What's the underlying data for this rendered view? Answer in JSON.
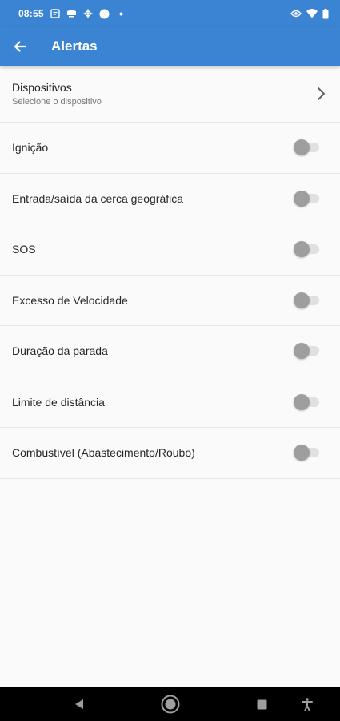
{
  "status_bar": {
    "time": "08:55",
    "icons_left": [
      "notes-icon",
      "message-icon",
      "settings-icon",
      "circle-icon",
      "dot-icon"
    ],
    "icons_right": [
      "eye-icon",
      "wifi-icon",
      "battery-icon"
    ]
  },
  "app_bar": {
    "title": "Alertas",
    "back_icon": "arrow-left-icon",
    "color": "#3a84d3"
  },
  "device_selector": {
    "title": "Dispositivos",
    "subtitle": "Selecione o dispositivo",
    "icon": "chevron-right-icon"
  },
  "alerts": [
    {
      "label": "Ignição",
      "enabled": false
    },
    {
      "label": "Entrada/saída da cerca geográfica",
      "enabled": false
    },
    {
      "label": "SOS",
      "enabled": false
    },
    {
      "label": "Excesso de Velocidade",
      "enabled": false
    },
    {
      "label": "Duração da parada",
      "enabled": false
    },
    {
      "label": "Limite de distância",
      "enabled": false
    },
    {
      "label": "Combustível (Abastecimento/Roubo)",
      "enabled": false
    }
  ],
  "nav_bar": {
    "icons": [
      "back-triangle-icon",
      "home-circle-icon",
      "recents-square-icon",
      "accessibility-icon"
    ]
  }
}
